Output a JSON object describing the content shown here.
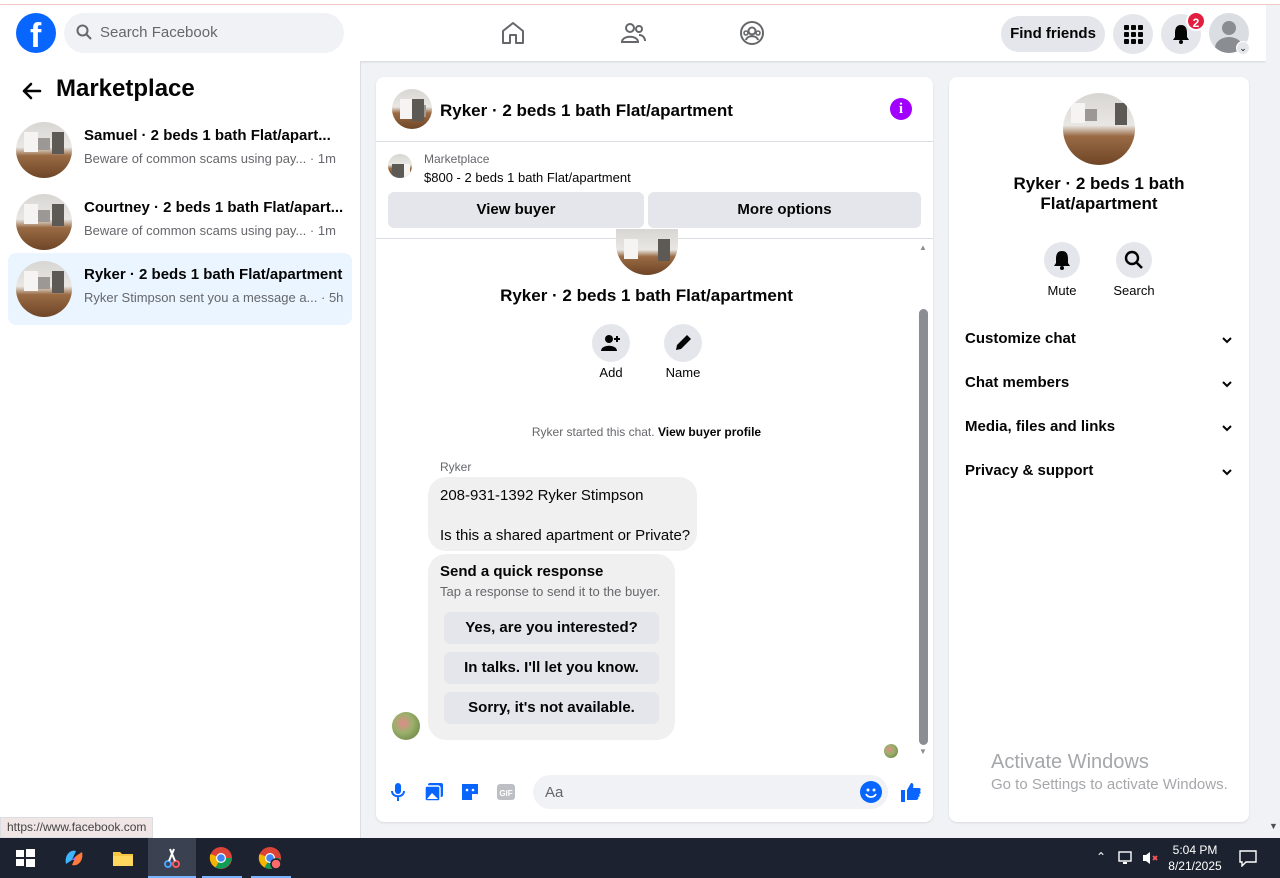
{
  "topbar": {
    "search_placeholder": "Search Facebook",
    "find_friends_label": "Find friends",
    "notifications_count": "2",
    "nav_icons": [
      "home-icon",
      "friends-icon",
      "groups-icon"
    ]
  },
  "sidebar": {
    "title": "Marketplace",
    "conversations": [
      {
        "name": "Samuel · 2 beds 1 bath Flat/apart...",
        "preview": "Beware of common scams using pay...",
        "time": "· 1m",
        "active": false
      },
      {
        "name": "Courtney · 2 beds 1 bath Flat/apart...",
        "preview": "Beware of common scams using pay...",
        "time": "· 1m",
        "active": false
      },
      {
        "name": "Ryker · 2 beds 1 bath Flat/apartment",
        "preview": "Ryker Stimpson sent you a message a...",
        "time": "· 5h",
        "active": true
      }
    ]
  },
  "status_url": "https://www.facebook.com",
  "chat": {
    "header_title": "Ryker · 2 beds 1 bath Flat/apartment",
    "marketplace_label": "Marketplace",
    "listing": "$800 - 2 beds 1 bath Flat/apartment",
    "view_buyer_label": "View buyer",
    "more_options_label": "More options",
    "intro_title": "Ryker · 2 beds 1 bath Flat/apartment",
    "add_label": "Add",
    "name_label": "Name",
    "started_text": "Ryker started this chat.",
    "view_profile_label": "View buyer profile",
    "sender": "Ryker",
    "message_line1": "208-931-1392 Ryker Stimpson",
    "message_line2": "Is this a shared apartment or Private?",
    "quick_title": "Send a quick response",
    "quick_sub": "Tap a response to send it to the buyer.",
    "quick_replies": [
      "Yes, are you interested?",
      "In talks. I'll let you know.",
      "Sorry, it's not available."
    ],
    "composer_placeholder": "Aa"
  },
  "right_panel": {
    "title_line1": "Ryker · 2 beds 1 bath",
    "title_line2": "Flat/apartment",
    "mute_label": "Mute",
    "search_label": "Search",
    "sections": [
      "Customize chat",
      "Chat members",
      "Media, files and links",
      "Privacy & support"
    ]
  },
  "watermark": {
    "line1": "Activate Windows",
    "line2": "Go to Settings to activate Windows."
  },
  "taskbar": {
    "time": "5:04 PM",
    "date": "8/21/2025"
  },
  "colors": {
    "brand_blue": "#0866ff",
    "info_purple": "#a100ff",
    "badge_red": "#e41e3f"
  }
}
